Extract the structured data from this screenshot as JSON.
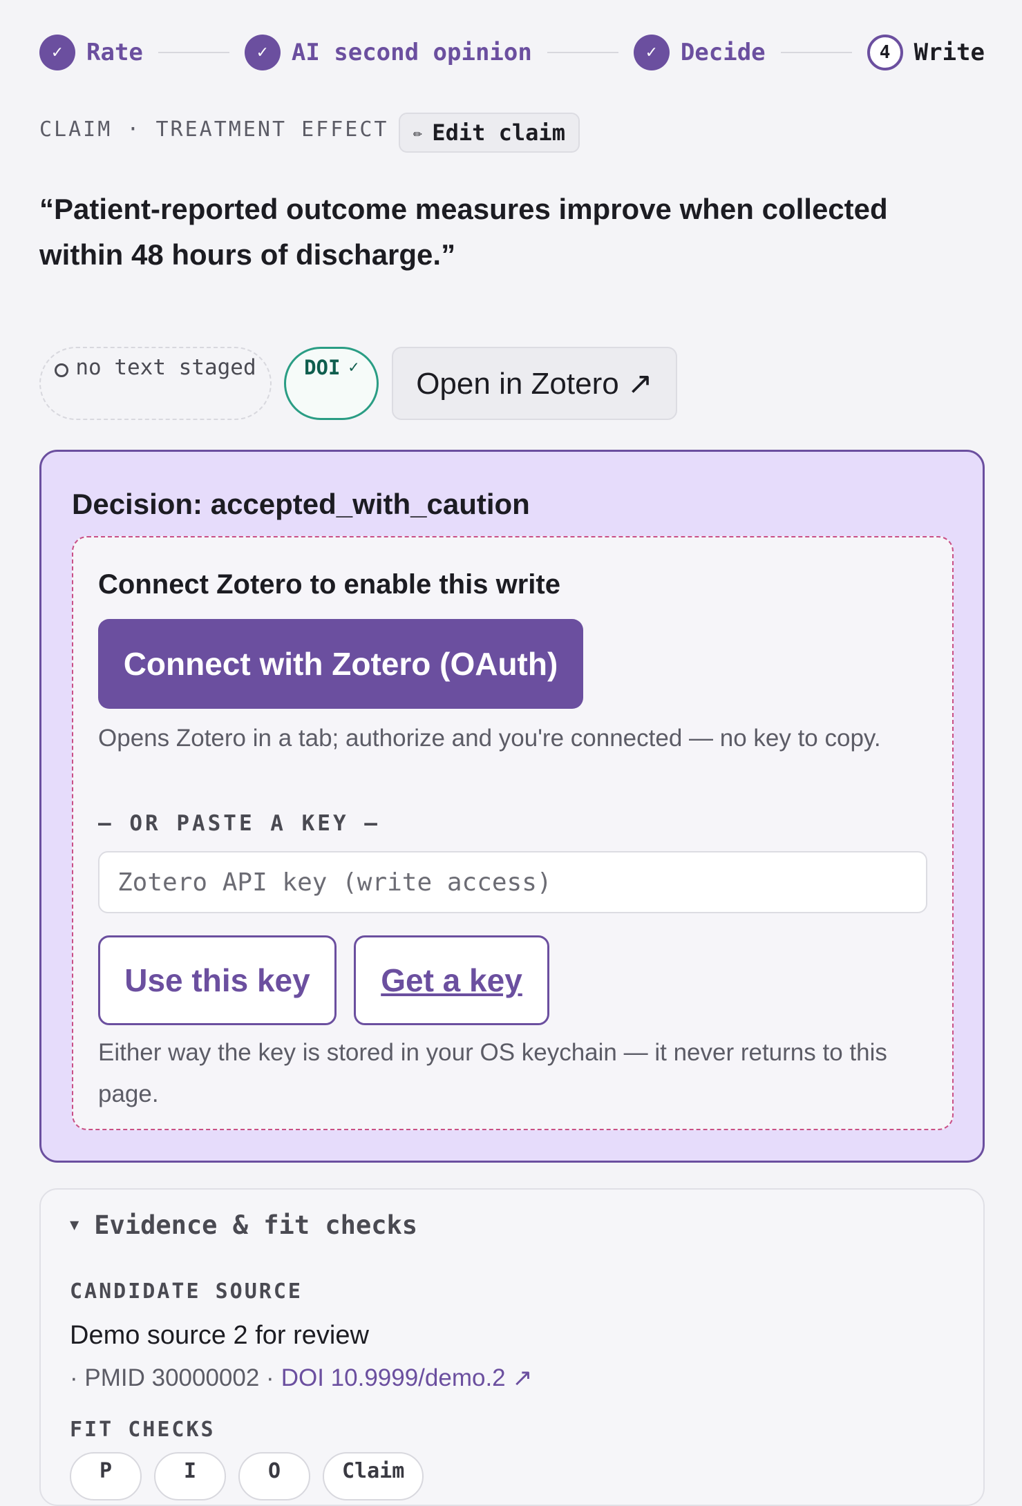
{
  "stepper": {
    "steps": [
      {
        "label": "Rate",
        "state": "done",
        "marker": "✓"
      },
      {
        "label": "AI second opinion",
        "state": "done",
        "marker": "✓"
      },
      {
        "label": "Decide",
        "state": "done",
        "marker": "✓"
      },
      {
        "label": "Write",
        "state": "current",
        "marker": "4"
      }
    ]
  },
  "claim": {
    "kicker": "CLAIM · TREATMENT EFFECT",
    "edit_icon": "✏",
    "edit_label": "Edit claim",
    "quote": "“Patient-reported outcome measures improve when collected within 48 hours of discharge.”"
  },
  "chips": {
    "no_text_label": "no text staged",
    "doi_label": "DOI",
    "doi_check": "✓",
    "open_zotero_label": "Open in Zotero ↗"
  },
  "decision": {
    "title": "Decision: accepted_with_caution",
    "connect_title": "Connect Zotero to enable this write",
    "oauth_button": "Connect with Zotero (OAuth)",
    "oauth_help": "Opens Zotero in a tab; authorize and you're connected — no key to copy.",
    "or_paste_label": "— OR PASTE A KEY —",
    "key_input_placeholder": "Zotero API key (write access)",
    "key_input_value": "",
    "use_key_button": "Use this key",
    "get_key_button": "Get a key",
    "keychain_note": "Either way the key is stored in your OS keychain — it never returns to this page."
  },
  "evidence": {
    "summary_marker": "▼",
    "summary_label": "Evidence & fit checks",
    "candidate_kicker": "CANDIDATE SOURCE",
    "source_title": "Demo source 2 for review",
    "source_pmid": "· PMID 30000002 ·",
    "source_doi": "DOI 10.9999/demo.2 ↗",
    "fit_kicker": "FIT CHECKS",
    "fit_chips": [
      "P",
      "I",
      "O",
      "Claim"
    ]
  },
  "colors": {
    "accent": "#6b4f9f",
    "decision_bg": "#e6dcfb",
    "connect_border": "#c94f86",
    "doi_border": "#2a9d84"
  }
}
